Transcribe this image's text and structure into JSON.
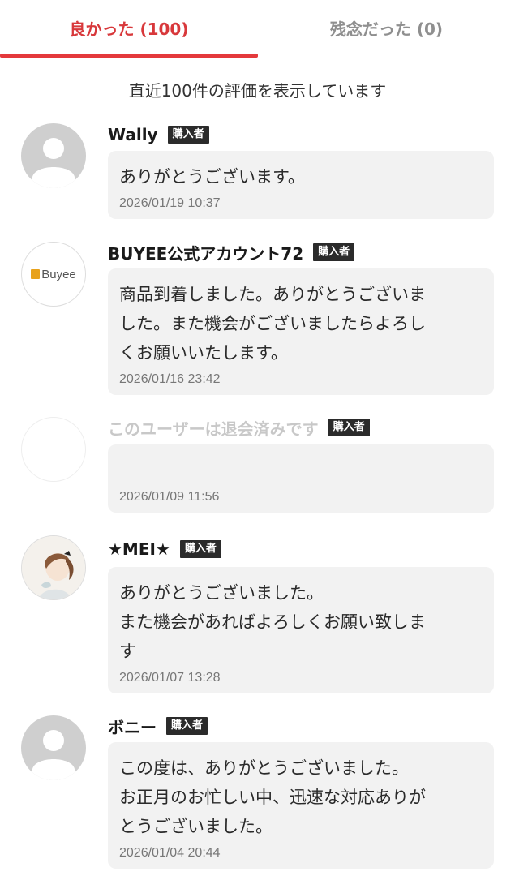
{
  "tabs": [
    {
      "label": "良かった (100)",
      "active": true
    },
    {
      "label": "残念だった (0)",
      "active": false
    }
  ],
  "notice": "直近100件の評価を表示しています",
  "reviews": [
    {
      "user": "Wally",
      "badge": "購入者",
      "avatar": "default-user-icon",
      "comment": "ありがとうございます。",
      "date": "2026/01/19 10:37"
    },
    {
      "user": "BUYEE公式アカウント72",
      "badge": "購入者",
      "avatar": "buyee-logo",
      "avatar_text": "Buyee",
      "comment": "商品到着しました。ありがとうございま\nした。また機会がございましたらよろし\nくお願いいたします。",
      "date": "2026/01/16 23:42"
    },
    {
      "user": "このユーザーは退会済みです",
      "badge": "購入者",
      "avatar": "blank",
      "comment": "",
      "date": "2026/01/09 11:56"
    },
    {
      "user": "★MEI★",
      "badge": "購入者",
      "avatar": "illustration-photo",
      "comment": "ありがとうございました。\nまた機会があればよろしくお願い致しま\nす",
      "date": "2026/01/07 13:28"
    },
    {
      "user": "ボニー",
      "badge": "購入者",
      "avatar": "default-user-icon",
      "comment": "この度は、ありがとうございました。\nお正月のお忙しい中、迅速な対応ありが\nとうございました。",
      "date": "2026/01/04 20:44"
    }
  ],
  "colors": {
    "accent": "#e4393c",
    "bubble": "#f2f2f2",
    "badge": "#2b2b2b"
  }
}
